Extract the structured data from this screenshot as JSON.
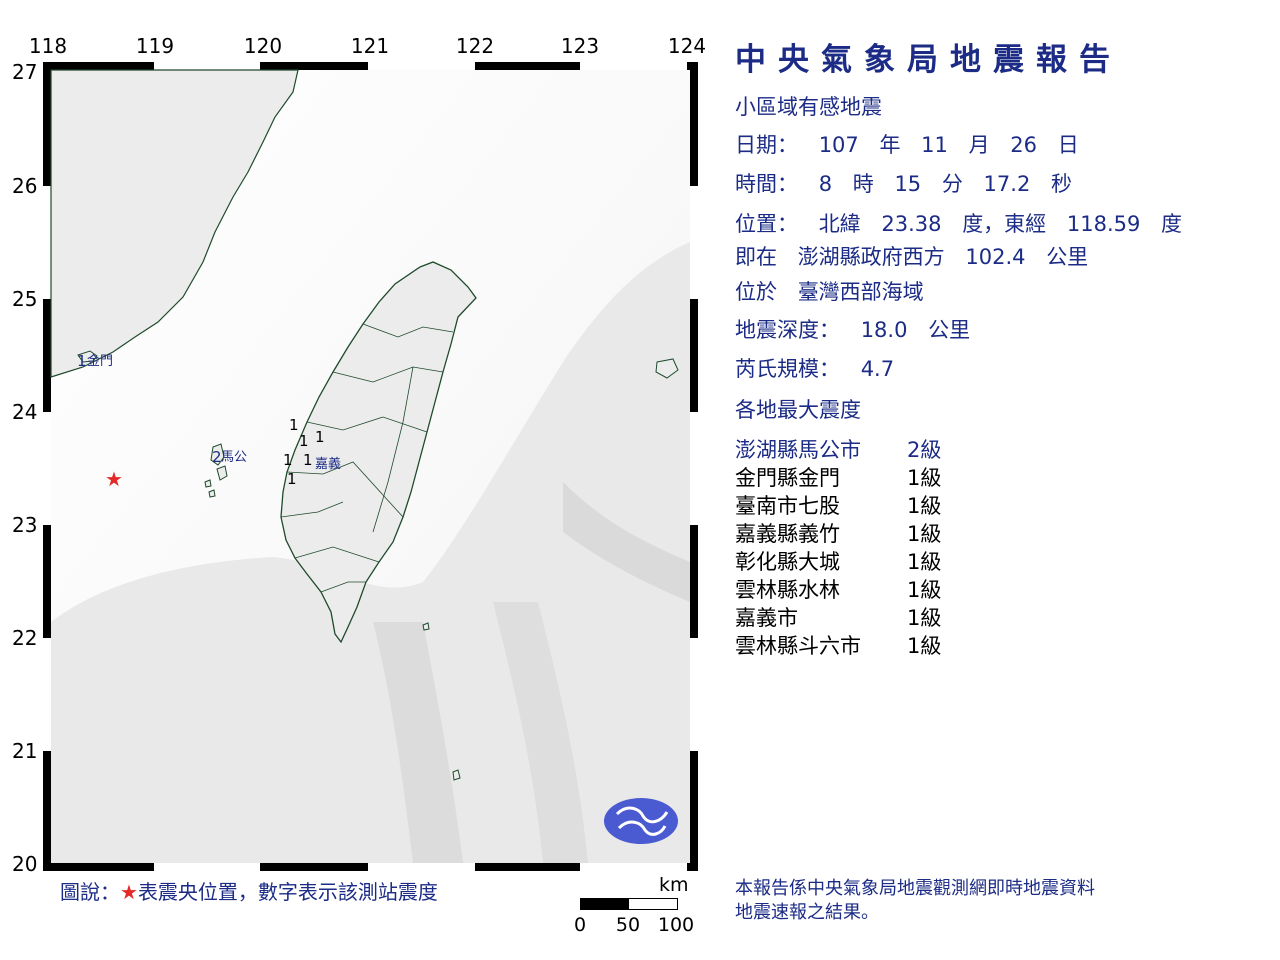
{
  "map": {
    "lon_ticks": [
      "118",
      "119",
      "120",
      "121",
      "122",
      "123",
      "124"
    ],
    "lat_ticks": [
      "27",
      "26",
      "25",
      "24",
      "23",
      "22",
      "21",
      "20"
    ],
    "place_labels": {
      "kinmen": "金門",
      "magong": "馬公",
      "chiayi": "嘉義"
    },
    "station_marks": {
      "kinmen": "1",
      "magong": "2",
      "others": [
        "1",
        "1",
        "1",
        "1",
        "1",
        "1"
      ]
    },
    "epicenter_color": "#e52828",
    "land_color": "#f2f2f2",
    "coast_color": "#1f4a2c",
    "logo_color": "#4a5ad0"
  },
  "legend": {
    "prefix": "圖說：",
    "star": "★",
    "text": "表震央位置，數字表示該測站震度"
  },
  "scale_bar": {
    "unit": "km",
    "labels": [
      "0",
      "50",
      "100"
    ]
  },
  "report": {
    "title": "中央氣象局地震報告",
    "type": "小區域有感地震",
    "date": {
      "label": "日期：",
      "year": "107",
      "year_unit": "年",
      "month": "11",
      "month_unit": "月",
      "day": "26",
      "day_unit": "日"
    },
    "time": {
      "label": "時間：",
      "hour": "8",
      "hour_unit": "時",
      "minute": "15",
      "minute_unit": "分",
      "second": "17.2",
      "second_unit": "秒"
    },
    "position": {
      "label": "位置：",
      "lat_label": "北緯",
      "lat": "23.38",
      "lat_unit": "度，東經",
      "lon": "118.59",
      "lon_unit": "度"
    },
    "relative": {
      "label": "即在",
      "reference": "澎湖縣政府西方",
      "distance": "102.4",
      "unit": "公里"
    },
    "region": {
      "label": "位於",
      "name": "臺灣西部海域"
    },
    "depth": {
      "label": "地震深度：",
      "value": "18.0",
      "unit": "公里"
    },
    "magnitude": {
      "label": "芮氏規模：",
      "value": "4.7"
    },
    "intensity_heading": "各地最大震度",
    "intensities": [
      {
        "location": "澎湖縣馬公市",
        "level": "2級"
      },
      {
        "location": "金門縣金門",
        "level": "1級"
      },
      {
        "location": "臺南市七股",
        "level": "1級"
      },
      {
        "location": "嘉義縣義竹",
        "level": "1級"
      },
      {
        "location": "彰化縣大城",
        "level": "1級"
      },
      {
        "location": "雲林縣水林",
        "level": "1級"
      },
      {
        "location": "嘉義市",
        "level": "1級"
      },
      {
        "location": "雲林縣斗六市",
        "level": "1級"
      }
    ],
    "footer_line1": "本報告係中央氣象局地震觀測網即時地震資料",
    "footer_line2": "地震速報之結果。"
  }
}
